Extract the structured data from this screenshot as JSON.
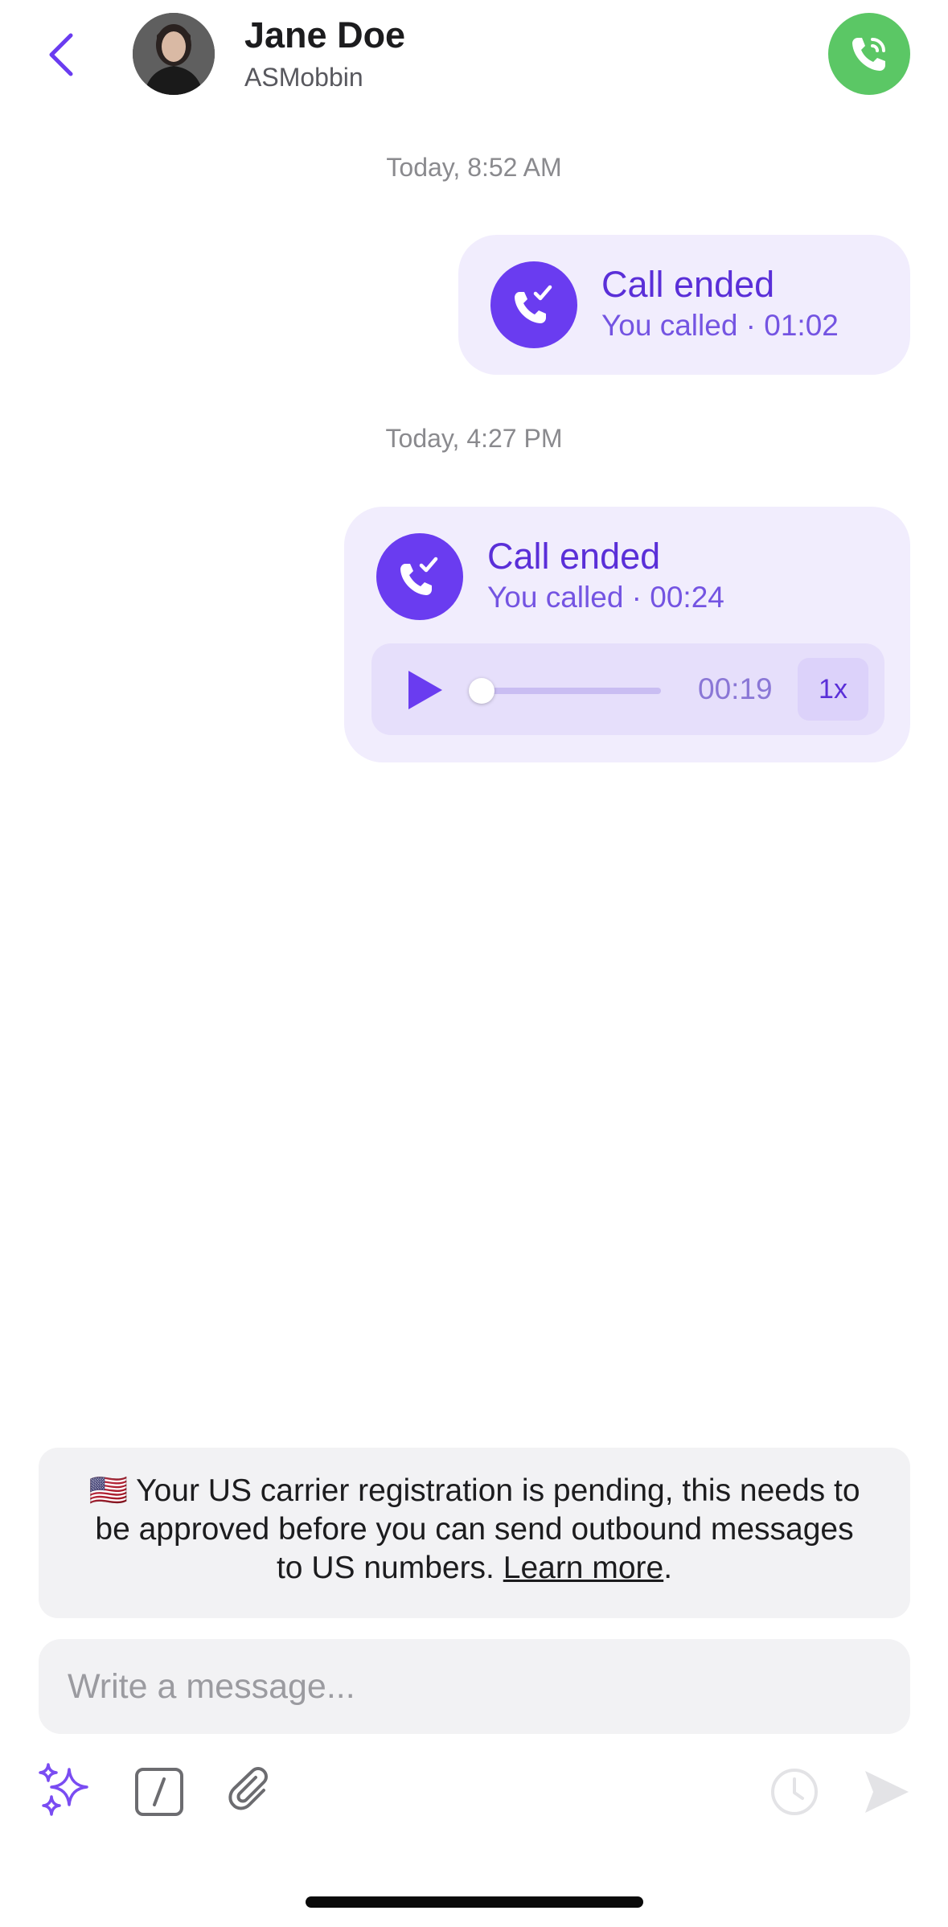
{
  "header": {
    "contact_name": "Jane Doe",
    "contact_subtitle": "ASMobbin",
    "back_icon": "chevron-left-icon",
    "call_icon": "phone-icon",
    "call_button_color": "#5bc765"
  },
  "conversation": {
    "groups": [
      {
        "timestamp": "Today, 8:52 AM",
        "call": {
          "title": "Call ended",
          "subtitle": "You called · 01:02"
        }
      },
      {
        "timestamp": "Today, 4:27 PM",
        "call": {
          "title": "Call ended",
          "subtitle": "You called · 00:24",
          "recording": {
            "time": "00:19",
            "speed": "1x",
            "progress": 0.04
          }
        }
      }
    ]
  },
  "notice": {
    "flag": "🇺🇸",
    "text": "Your US carrier registration is pending, this needs to be approved before you can send outbound messages to US numbers.",
    "link": "Learn more",
    "suffix": "."
  },
  "composer": {
    "placeholder": "Write a message...",
    "tools": [
      "sparkles-icon",
      "slash-command-icon",
      "paperclip-icon",
      "clock-icon",
      "send-icon"
    ]
  },
  "colors": {
    "accent": "#6a3cf0",
    "bubble": "#f1edfd",
    "call_green": "#5bc765"
  }
}
